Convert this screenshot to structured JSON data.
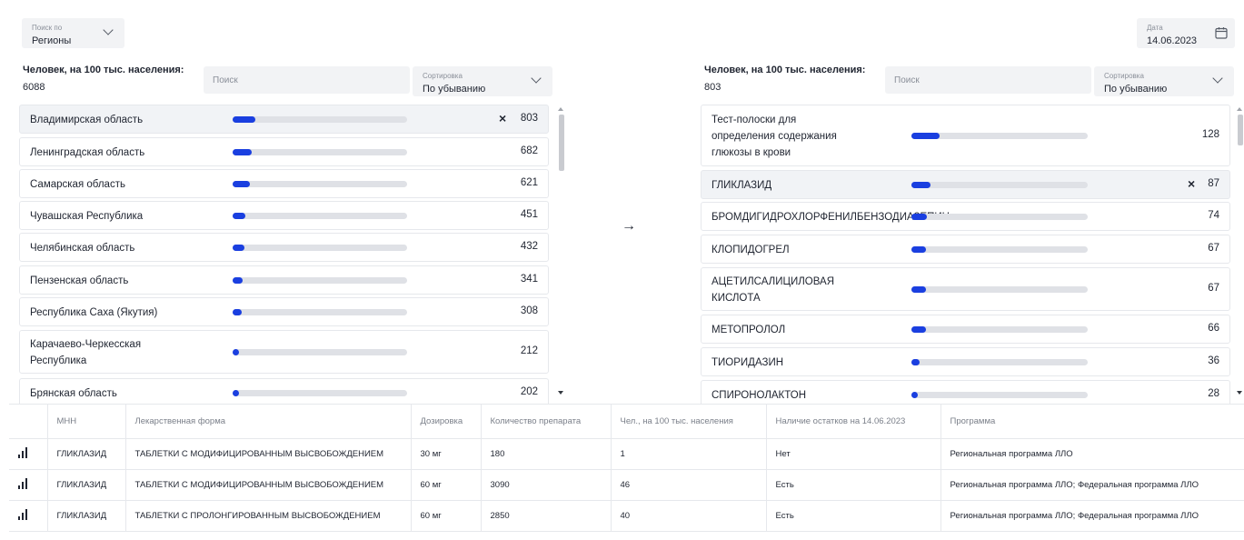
{
  "header": {
    "search_by": {
      "caption": "Поиск по",
      "value": "Регионы"
    },
    "date": {
      "caption": "Дата",
      "value": "14.06.2023"
    }
  },
  "left_panel": {
    "count_label": "Человек, на 100 тыс. населения:",
    "count_value": "6088",
    "search_placeholder": "Поиск",
    "sort": {
      "caption": "Сортировка",
      "value": "По убыванию"
    },
    "items": [
      {
        "label": "Владимирская область",
        "value": "803",
        "fraction": 0.13,
        "selected": true
      },
      {
        "label": "Ленинградская область",
        "value": "682",
        "fraction": 0.11
      },
      {
        "label": "Самарская область",
        "value": "621",
        "fraction": 0.1
      },
      {
        "label": "Чувашская Республика",
        "value": "451",
        "fraction": 0.075
      },
      {
        "label": "Челябинская область",
        "value": "432",
        "fraction": 0.07
      },
      {
        "label": "Пензенская область",
        "value": "341",
        "fraction": 0.055
      },
      {
        "label": "Республика Саха (Якутия)",
        "value": "308",
        "fraction": 0.05
      },
      {
        "label": "Карачаево-Черкесская\nРеспублика",
        "value": "212",
        "fraction": 0.035
      },
      {
        "label": "Брянская область",
        "value": "202",
        "fraction": 0.033
      }
    ]
  },
  "right_panel": {
    "count_label": "Человек, на 100 тыс. населения:",
    "count_value": "803",
    "search_placeholder": "Поиск",
    "sort": {
      "caption": "Сортировка",
      "value": "По убыванию"
    },
    "items": [
      {
        "label": "Тест-полоски для\nопределения содержания\nглюкозы в крови",
        "value": "128",
        "fraction": 0.16
      },
      {
        "label": "ГЛИКЛАЗИД",
        "value": "87",
        "fraction": 0.11,
        "selected": true
      },
      {
        "label": "БРОМДИГИДРОХЛОРФЕНИЛБЕНЗОДИАЗЕПИН",
        "value": "74",
        "fraction": 0.09
      },
      {
        "label": "КЛОПИДОГРЕЛ",
        "value": "67",
        "fraction": 0.08
      },
      {
        "label": "АЦЕТИЛСАЛИЦИЛОВАЯ\nКИСЛОТА",
        "value": "67",
        "fraction": 0.08
      },
      {
        "label": "МЕТОПРОЛОЛ",
        "value": "66",
        "fraction": 0.08
      },
      {
        "label": "ТИОРИДАЗИН",
        "value": "36",
        "fraction": 0.045
      },
      {
        "label": "СПИРОНОЛАКТОН",
        "value": "28",
        "fraction": 0.035
      }
    ]
  },
  "colors": {
    "accent": "#1a3fe0",
    "track": "#dfe1e6"
  },
  "table": {
    "columns": [
      "МНН",
      "Лекарственная форма",
      "Дозировка",
      "Количество препарата",
      "Чел., на 100 тыс. населения",
      "Наличие остатков на 14.06.2023",
      "Программа"
    ],
    "rows": [
      [
        "ГЛИКЛАЗИД",
        "ТАБЛЕТКИ С МОДИФИЦИРОВАННЫМ ВЫСВОБОЖДЕНИЕМ",
        "30 мг",
        "180",
        "1",
        "Нет",
        "Региональная программа ЛЛО"
      ],
      [
        "ГЛИКЛАЗИД",
        "ТАБЛЕТКИ С МОДИФИЦИРОВАННЫМ ВЫСВОБОЖДЕНИЕМ",
        "60 мг",
        "3090",
        "46",
        "Есть",
        "Региональная программа ЛЛО; Федеральная программа ЛЛО"
      ],
      [
        "ГЛИКЛАЗИД",
        "ТАБЛЕТКИ С ПРОЛОНГИРОВАННЫМ ВЫСВОБОЖДЕНИЕМ",
        "60 мг",
        "2850",
        "40",
        "Есть",
        "Региональная программа ЛЛО; Федеральная программа ЛЛО"
      ]
    ]
  }
}
